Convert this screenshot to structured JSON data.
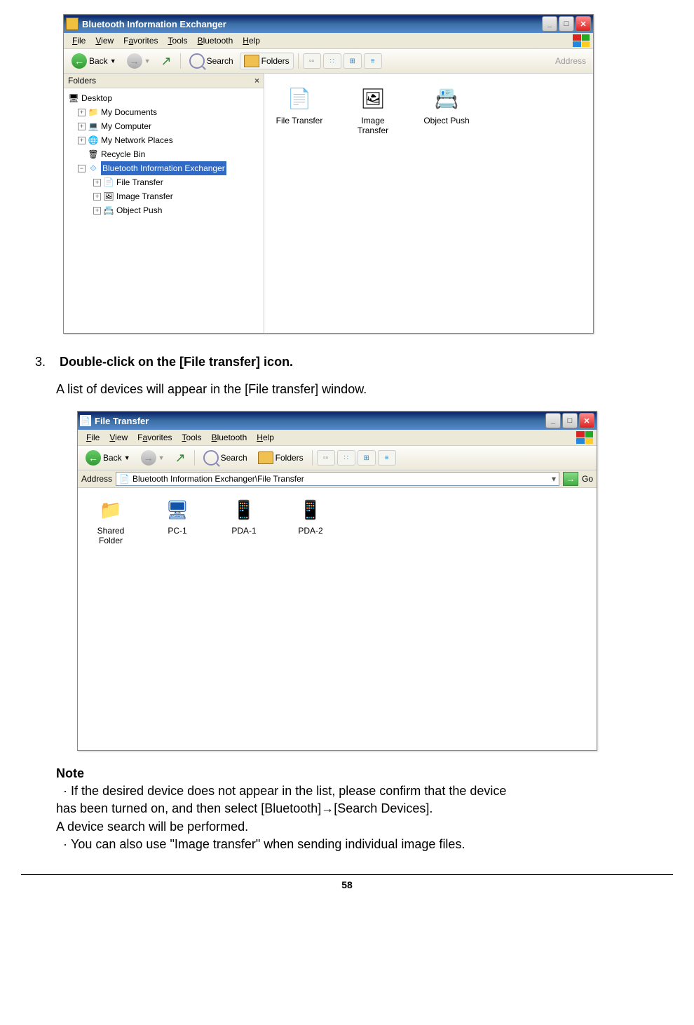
{
  "win1": {
    "title": "Bluetooth Information Exchanger",
    "menus": [
      "File",
      "View",
      "Favorites",
      "Tools",
      "Bluetooth",
      "Help"
    ],
    "back": "Back",
    "search": "Search",
    "folders": "Folders",
    "address": "Address",
    "panelTitle": "Folders",
    "tree": {
      "desktop": "Desktop",
      "docs": "My Documents",
      "comp": "My Computer",
      "net": "My Network Places",
      "bin": "Recycle Bin",
      "bie": "Bluetooth Information Exchanger",
      "ft": "File Transfer",
      "it": "Image Transfer",
      "op": "Object Push"
    },
    "icons": {
      "ft": "File Transfer",
      "it": "Image\nTransfer",
      "op": "Object Push"
    }
  },
  "step": {
    "num": "3.",
    "bold": "Double-click on the [File transfer] icon.",
    "text": "A list of devices will appear in the [File transfer] window."
  },
  "win2": {
    "title": "File Transfer",
    "menus": [
      "File",
      "View",
      "Favorites",
      "Tools",
      "Bluetooth",
      "Help"
    ],
    "back": "Back",
    "search": "Search",
    "folders": "Folders",
    "addrlbl": "Address",
    "go": "Go",
    "path": "Bluetooth Information Exchanger\\File Transfer",
    "devs": [
      "Shared Folder",
      "PC-1",
      "PDA-1",
      "PDA-2"
    ]
  },
  "note": {
    "title": "Note",
    "l1": "If the desired device does not appear in the list, please confirm that the device",
    "l2": "has been turned on, and then select [Bluetooth]→[Search Devices].",
    "l3": "A device search will be performed.",
    "l4": "You can also use \"Image transfer\" when sending individual image files."
  },
  "pagenum": "58"
}
